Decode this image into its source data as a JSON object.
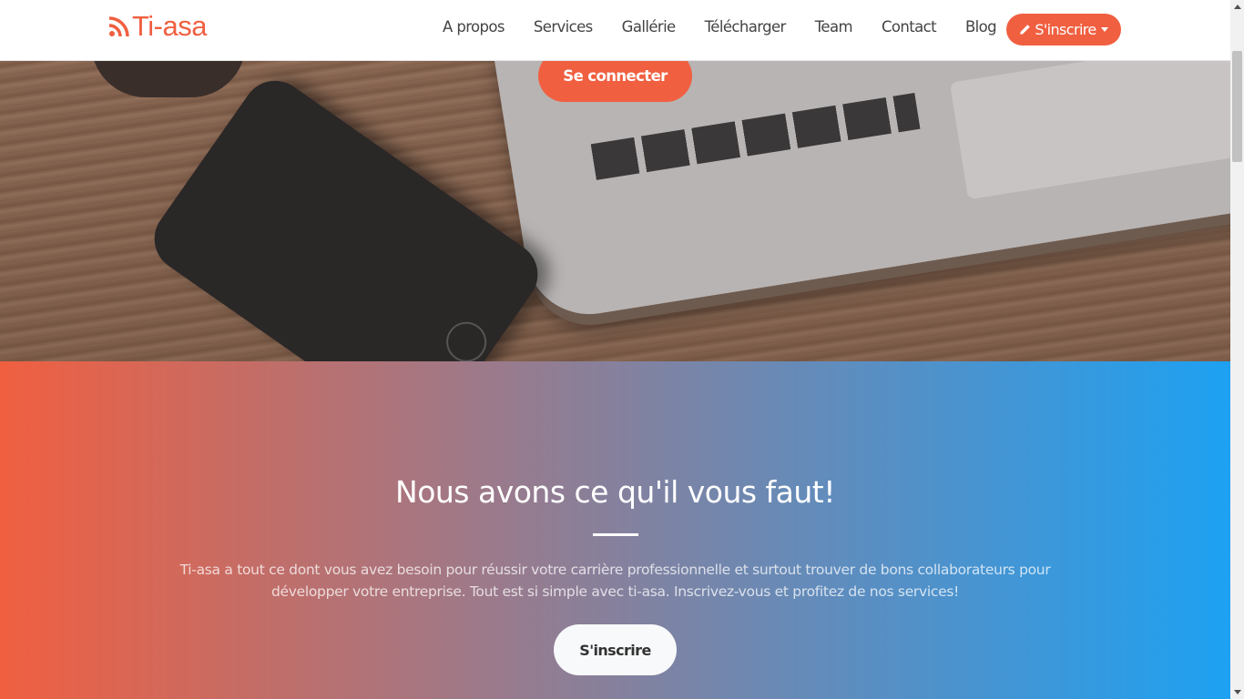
{
  "brand": {
    "name": "Ti-asa",
    "color": "#f05f40"
  },
  "nav": {
    "links": [
      "A propos",
      "Services",
      "Gallérie",
      "Télécharger",
      "Team",
      "Contact",
      "Blog"
    ],
    "signup_label": "S'inscrire"
  },
  "hero": {
    "login_label": "Se connecter"
  },
  "promo": {
    "title": "Nous avons ce qu'il vous faut!",
    "text": "Ti-asa a tout ce dont vous avez besoin pour réussir votre carrière professionnelle et surtout trouver de bons collaborateurs pour développer votre entreprise. Tout est si simple avec ti-asa. Inscrivez-vous et profitez de nos services!",
    "button_label": "S'inscrire",
    "gradient": [
      "#f05f40",
      "#1da1f2"
    ]
  },
  "icons": {
    "logo": "rss-icon",
    "signup": "pencil-icon"
  }
}
